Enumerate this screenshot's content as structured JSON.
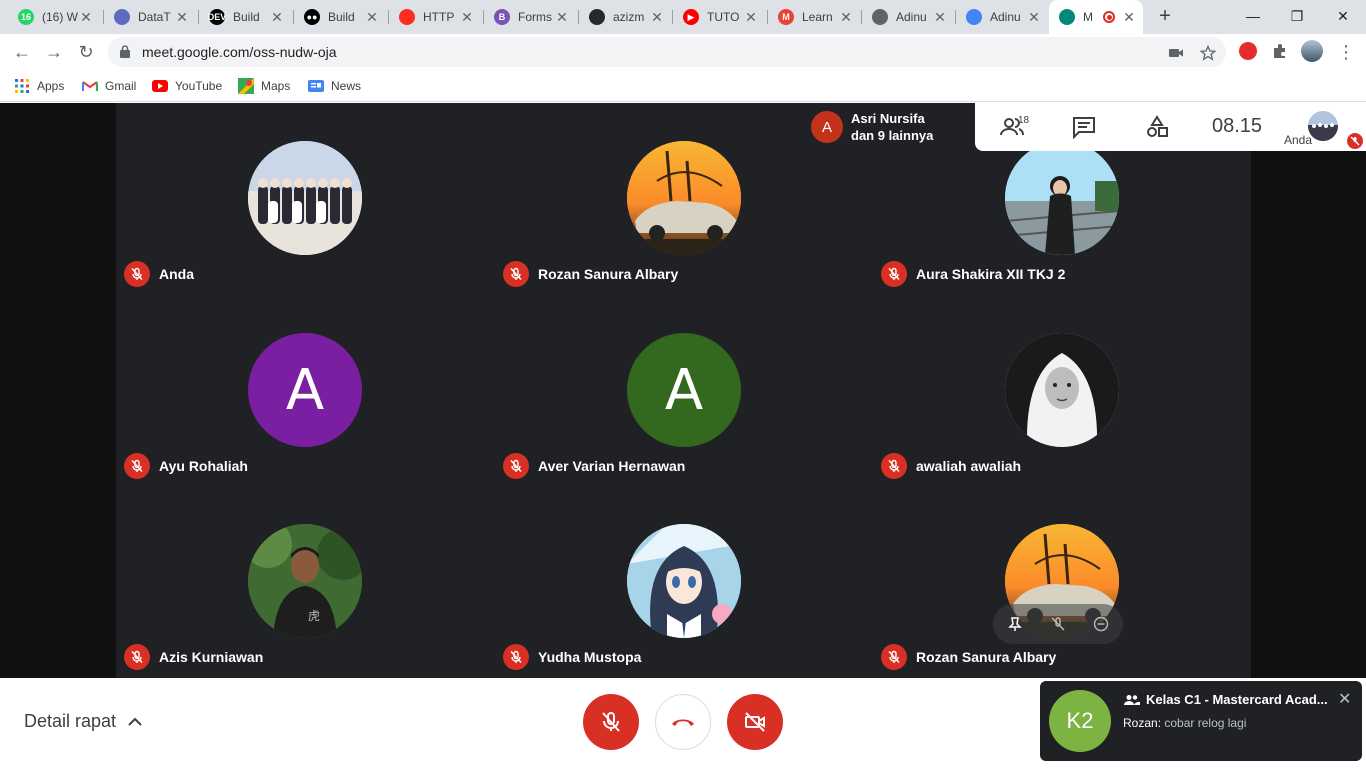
{
  "browser": {
    "tabs": [
      {
        "title": "(16) W",
        "icon": "whatsapp-icon",
        "color": "#25d366",
        "badge": "16"
      },
      {
        "title": "DataT",
        "icon": "globe-icon",
        "color": "#5c6bc0",
        "badge": ""
      },
      {
        "title": "Build",
        "icon": "dev-icon",
        "color": "#000000",
        "badge": "DEV"
      },
      {
        "title": "Build",
        "icon": "medium-icon",
        "color": "#000000",
        "badge": "●●"
      },
      {
        "title": "HTTP",
        "icon": "laravel-icon",
        "color": "#ff2d20",
        "badge": ""
      },
      {
        "title": "Forms",
        "icon": "bootstrap-icon",
        "color": "#7952b3",
        "badge": "B"
      },
      {
        "title": "azizm",
        "icon": "github-icon",
        "color": "#24292e",
        "badge": ""
      },
      {
        "title": "TUTO",
        "icon": "youtube-icon",
        "color": "#ff0000",
        "badge": "▶"
      },
      {
        "title": "Learn",
        "icon": "gmail-icon",
        "color": "#ea4335",
        "badge": "M"
      },
      {
        "title": "Adinu",
        "icon": "globe-icon",
        "color": "#5f6368",
        "badge": ""
      },
      {
        "title": "Adinu",
        "icon": "send-icon",
        "color": "#4285f4",
        "badge": ""
      },
      {
        "title": "M",
        "icon": "meet-icon",
        "color": "#00897b",
        "badge": "",
        "active": true
      }
    ],
    "url": "meet.google.com/oss-nudw-oja",
    "bookmarks": [
      {
        "label": "Apps",
        "icon": "apps-grid-icon"
      },
      {
        "label": "Gmail",
        "icon": "gmail-icon"
      },
      {
        "label": "YouTube",
        "icon": "youtube-icon"
      },
      {
        "label": "Maps",
        "icon": "maps-icon"
      },
      {
        "label": "News",
        "icon": "news-icon"
      }
    ]
  },
  "meet": {
    "speaker": {
      "initial": "A",
      "line1": "Asri Nursifa",
      "line2": "dan 9 lainnya"
    },
    "participant_count": "18",
    "time": "08.15",
    "self_label": "Anda",
    "participants": [
      {
        "name": "Anda",
        "avatar": "photo-group",
        "color": "#b0c4de"
      },
      {
        "name": "Rozan Sanura Albary",
        "avatar": "photo-car-sunset",
        "color": "#e0a040"
      },
      {
        "name": "Aura Shakira XII TKJ 2",
        "avatar": "photo-railway",
        "color": "#87ceeb"
      },
      {
        "name": "Ayu Rohaliah",
        "avatar": "letter",
        "letter": "A",
        "color": "#7b1fa2"
      },
      {
        "name": "Aver Varian Hernawan",
        "avatar": "letter",
        "letter": "A",
        "color": "#33691e"
      },
      {
        "name": "awaliah awaliah",
        "avatar": "photo-hijab-bw",
        "color": "#cfcfcf"
      },
      {
        "name": "Azis Kurniawan",
        "avatar": "photo-forest",
        "color": "#3e6b2f"
      },
      {
        "name": "Yudha Mustopa",
        "avatar": "photo-anime",
        "color": "#8fb8d8"
      },
      {
        "name": "Rozan Sanura Albary",
        "avatar": "photo-car-sunset",
        "color": "#e0a040"
      }
    ],
    "bottom": {
      "details_label": "Detail rapat",
      "chat": {
        "avatar": "K2",
        "title": "Kelas C1 - Mastercard Acad...",
        "sender": "Rozan:",
        "message": "cobar relog lagi"
      }
    }
  }
}
